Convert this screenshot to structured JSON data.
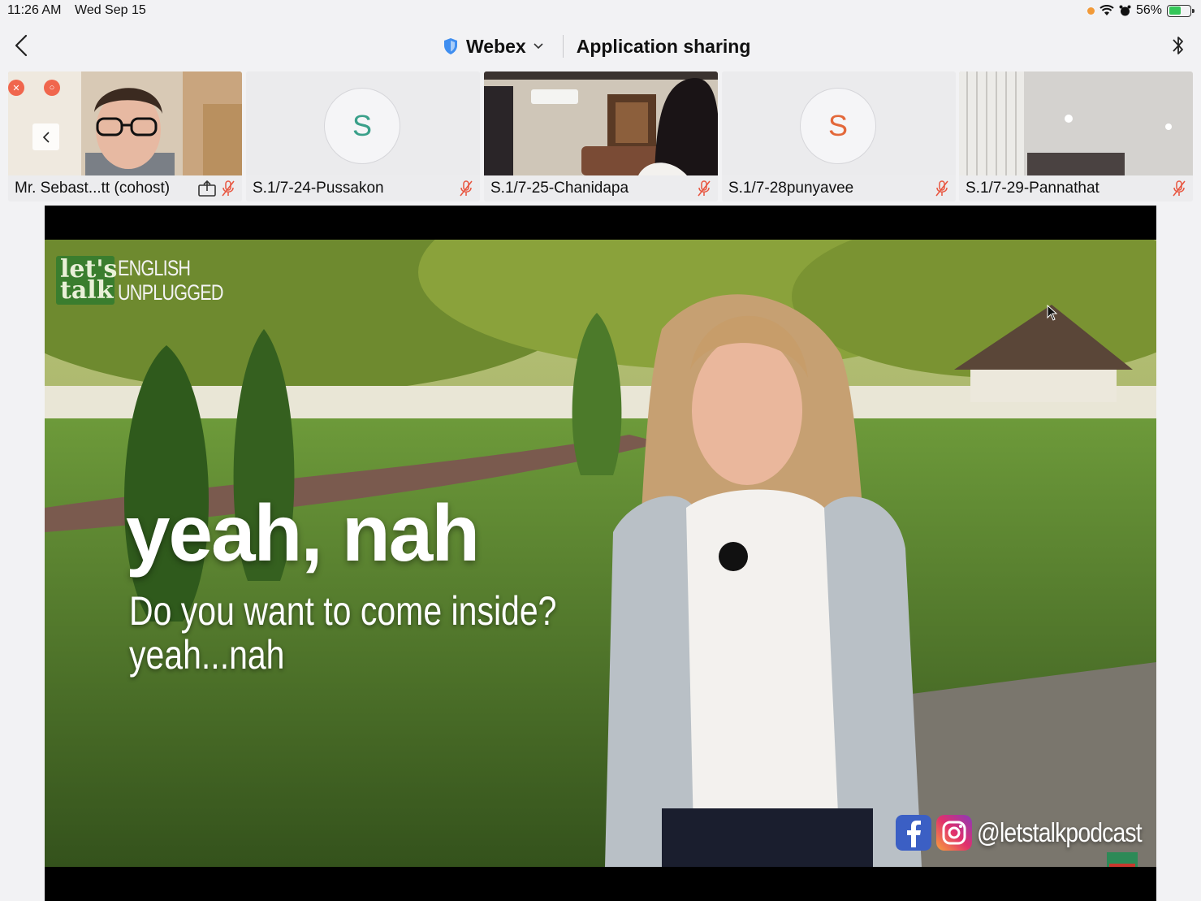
{
  "status_bar": {
    "time": "11:26 AM",
    "date": "Wed Sep 15",
    "battery": "56%",
    "battery_level": 0.56,
    "icons": [
      "recording-dot-icon",
      "wifi-icon",
      "alarm-icon",
      "battery-charging-icon"
    ]
  },
  "nav": {
    "back_icon": "chevron-left-icon",
    "app_name": "Webex",
    "app_icon": "shield-icon",
    "dropdown_icon": "chevron-down-icon",
    "title": "Application sharing",
    "right_icon": "bluetooth-icon"
  },
  "participants": [
    {
      "name": "Mr. Sebast...tt (cohost)",
      "video": true,
      "muted": true,
      "sharing": true
    },
    {
      "name": "S.1/7-24-Pussakon",
      "video": false,
      "initial": "S",
      "avatar_color": "#3aa08a",
      "muted": true
    },
    {
      "name": "S.1/7-25-Chanidapa",
      "video": true,
      "muted": true
    },
    {
      "name": "S.1/7-28punyavee",
      "video": false,
      "initial": "S",
      "avatar_color": "#e3683a",
      "muted": true
    },
    {
      "name": "S.1/7-29-Pannathat",
      "video": true,
      "muted": true
    }
  ],
  "shared_content": {
    "logo_mark": "let's talk",
    "logo_words_1": "ENGLISH",
    "logo_words_2": "UNPLUGGED",
    "caption_main": "yeah, nah",
    "caption_line_1": "Do you want to come inside?",
    "caption_line_2": "yeah...nah",
    "social_handle": "@letstalkpodcast",
    "social_icons": [
      "facebook-icon",
      "instagram-icon"
    ]
  },
  "colors": {
    "mute_red": "#e8553f",
    "accent_blue": "#3f8ef0",
    "grass": "#4e7a2e"
  }
}
